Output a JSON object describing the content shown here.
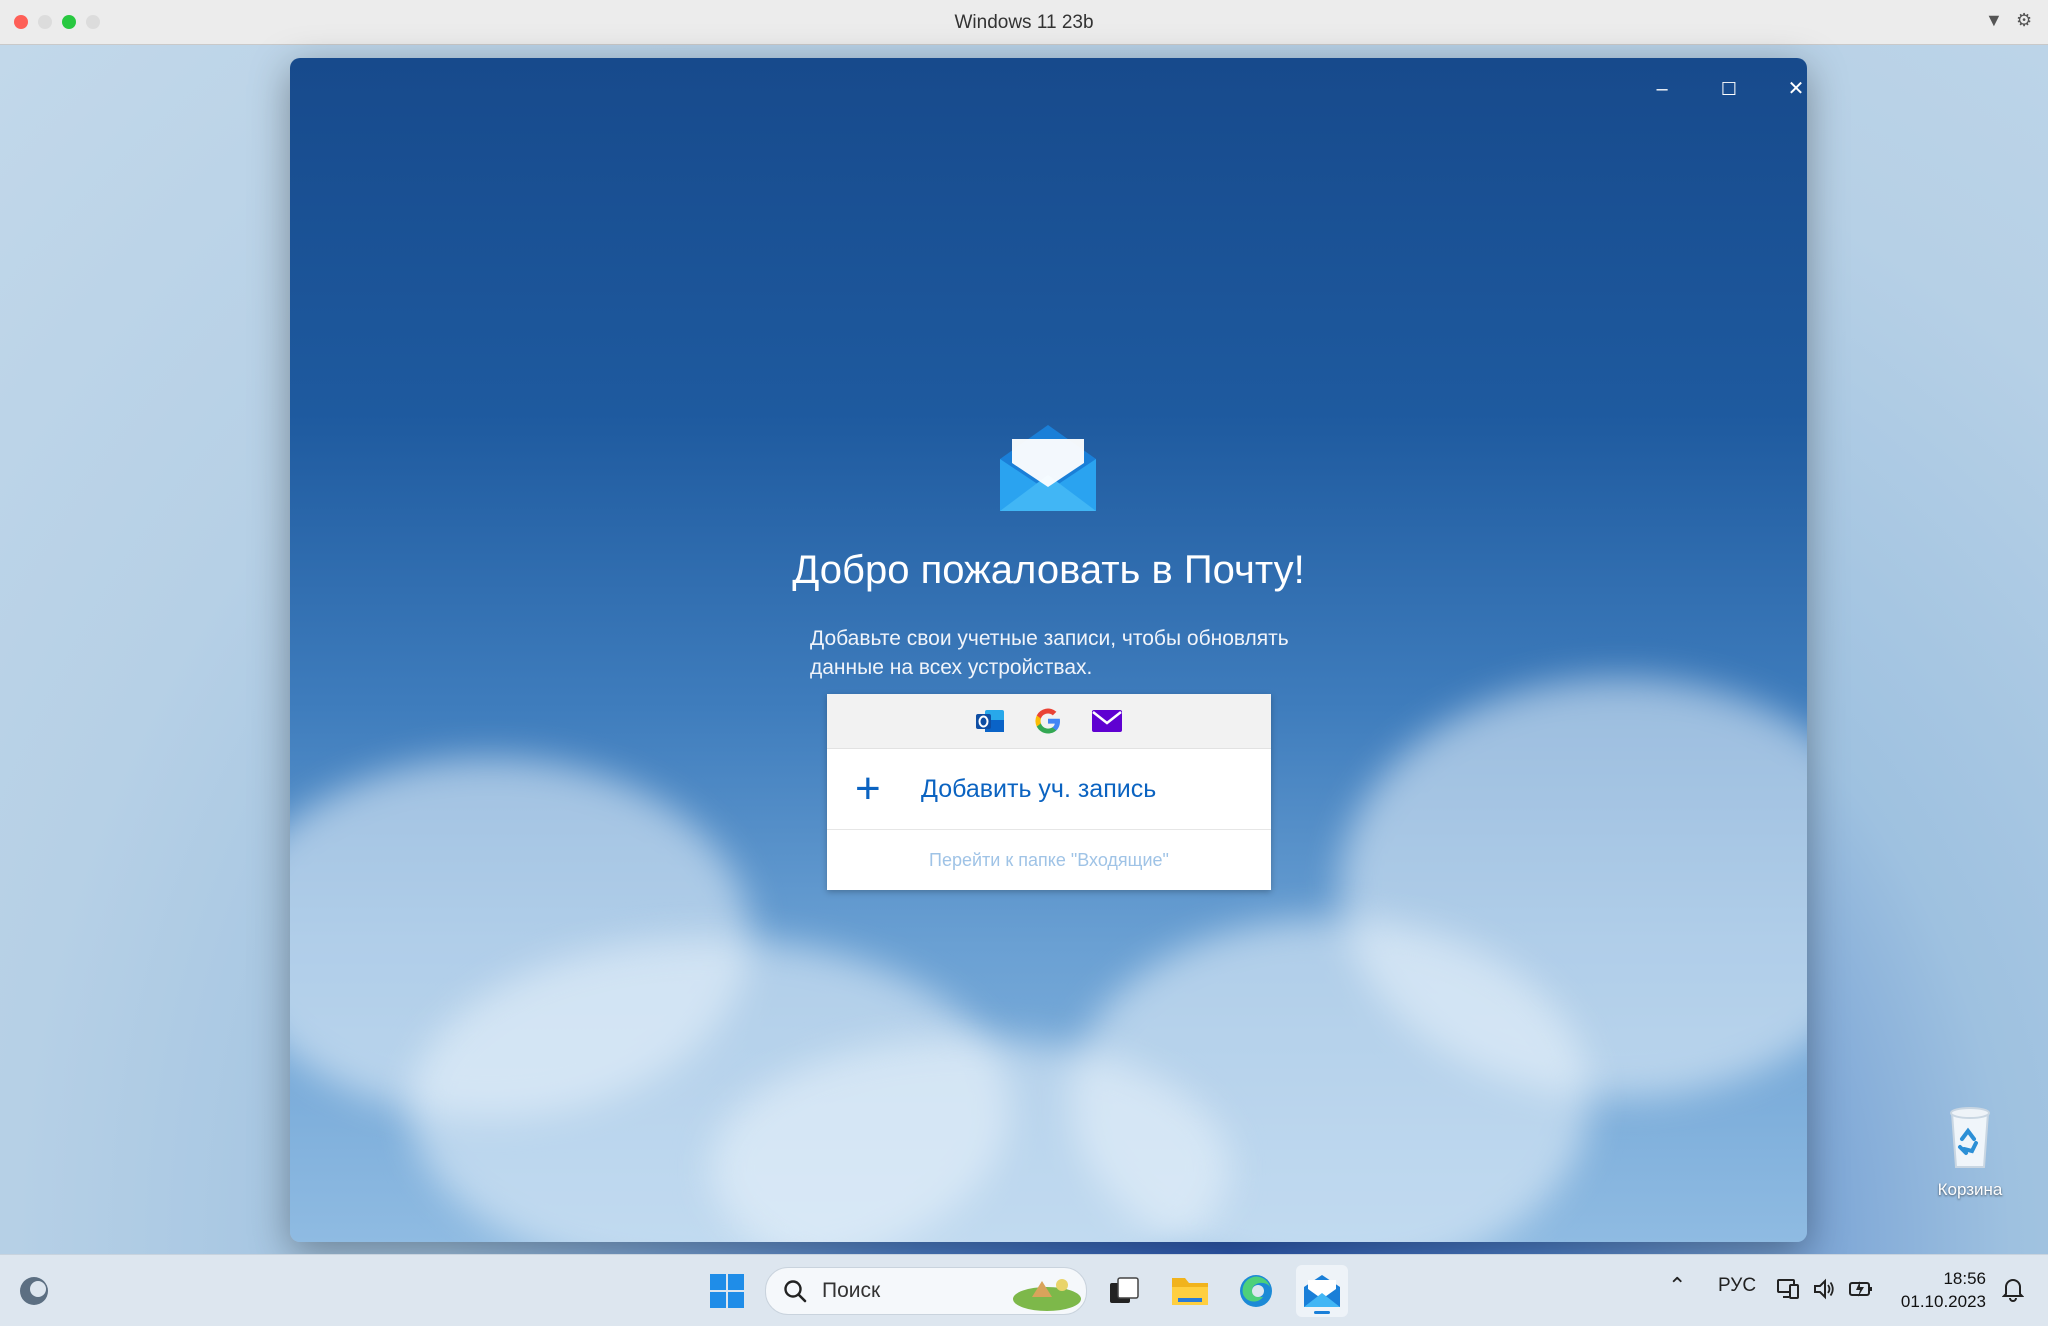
{
  "host": {
    "title": "Windows 11 23b",
    "traffic_colors": [
      "#fe5f57",
      "#dcdcdc",
      "#28c840",
      "#dcdcdc"
    ]
  },
  "mail_window": {
    "controls": {
      "minimize": "–",
      "maximize": "☐",
      "close": "✕"
    },
    "welcome_title": "Добро пожаловать в Почту!",
    "subtitle_line1": "Добавьте свои учетные записи, чтобы обновлять",
    "subtitle_line2": "данные на всех устройствах.",
    "providers": [
      "outlook-icon",
      "google-icon",
      "yahoo-mail-icon"
    ],
    "add_account_label": "Добавить уч. запись",
    "go_to_inbox_label": "Перейти к папке \"Входящие\""
  },
  "desktop": {
    "recycle_bin_label": "Корзина"
  },
  "taskbar": {
    "search_placeholder": "Поиск",
    "language": "РУС",
    "time": "18:56",
    "date": "01.10.2023",
    "pinned": [
      "windows-start-icon",
      "search-icon",
      "task-view-icon",
      "file-explorer-icon",
      "edge-icon",
      "mail-icon"
    ]
  },
  "colors": {
    "accent": "#0b63c1",
    "taskbar": "#dde6ef"
  }
}
